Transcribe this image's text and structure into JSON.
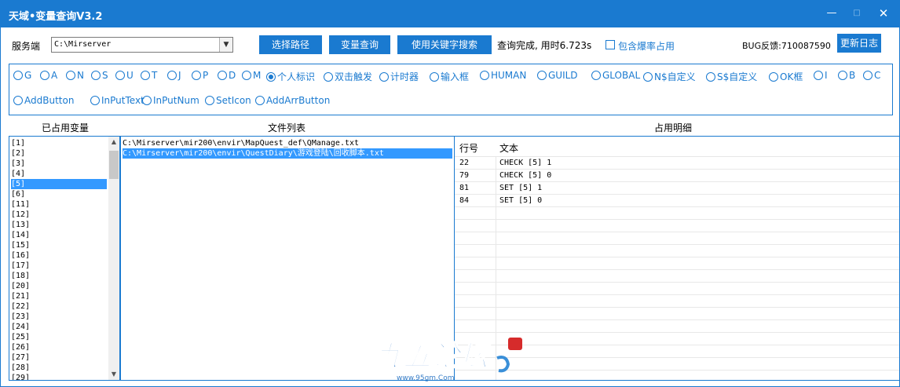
{
  "window": {
    "title": "天域•变量查询V3.2",
    "controls": {
      "minimize": "—",
      "maximize": "□",
      "close": "✕"
    }
  },
  "toolbar": {
    "server_label": "服务端",
    "server_path": "C:\\Mirserver",
    "select_path_button": "选择路径",
    "query_button": "变量查询",
    "keyword_search_button": "使用关键字搜索",
    "status": "查询完成, 用时6.723s",
    "include_explode_label": "包含爆率占用",
    "include_explode_checked": false,
    "bug_feedback": "BUG反馈:710087590",
    "changelog_button": "更新日志"
  },
  "radio_options": {
    "row1": [
      "G",
      "A",
      "N",
      "S",
      "U",
      "T",
      "J",
      "P",
      "D",
      "M",
      "个人标识",
      "双击触发",
      "计时器",
      "输入框",
      "HUMAN",
      "GUILD",
      "GLOBAL",
      "N$自定义",
      "S$自定义",
      "OK框",
      "I",
      "B",
      "C"
    ],
    "row2": [
      "AddButton",
      "InPutText",
      "InPutNum",
      "SetIcon",
      "AddArrButton"
    ],
    "selected": "个人标识"
  },
  "headers": {
    "used_vars": "已占用变量",
    "file_list": "文件列表",
    "detail": "占用明细"
  },
  "used_vars": {
    "items": [
      "[1]",
      "[2]",
      "[3]",
      "[4]",
      "[5]",
      "[6]",
      "[11]",
      "[12]",
      "[13]",
      "[14]",
      "[15]",
      "[16]",
      "[17]",
      "[18]",
      "[20]",
      "[21]",
      "[22]",
      "[23]",
      "[24]",
      "[25]",
      "[26]",
      "[27]",
      "[28]",
      "[29]"
    ],
    "selected_index": 4
  },
  "file_list": {
    "items": [
      "C:\\Mirserver\\mir200\\envir\\MapQuest_def\\QManage.txt",
      "C:\\Mirserver\\mir200\\envir\\QuestDiary\\游戏登陆\\回收脚本.txt"
    ],
    "selected_index": 1
  },
  "detail": {
    "columns": [
      "行号",
      "文本"
    ],
    "rows": [
      {
        "line": "22",
        "text": "CHECK [5] 1"
      },
      {
        "line": "79",
        "text": "CHECK [5] 0"
      },
      {
        "line": "81",
        "text": "SET [5] 1"
      },
      {
        "line": "84",
        "text": "SET [5] 0"
      }
    ]
  },
  "watermark": {
    "logo_text": "九五论坛",
    "url": "www.95gm.Com"
  },
  "colors": {
    "accent": "#1a7ad0",
    "selection": "#3399ff"
  }
}
